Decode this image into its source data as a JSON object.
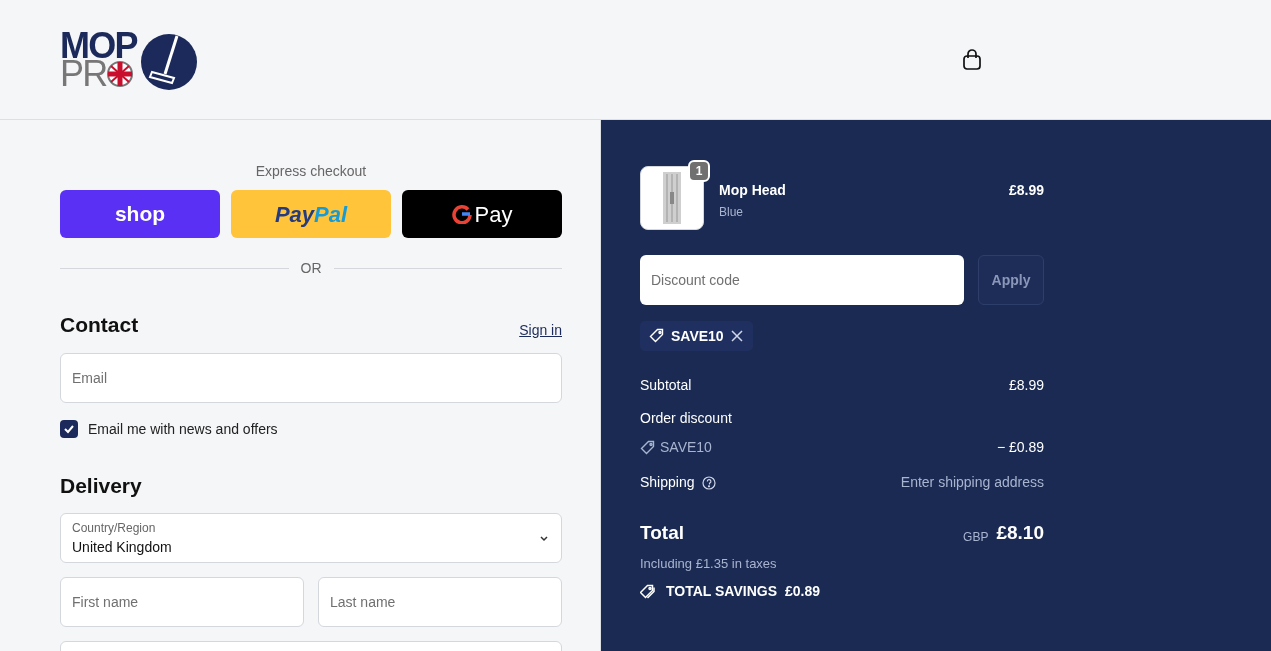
{
  "header": {
    "logo": {
      "top": "MOP",
      "bottom": "PR"
    }
  },
  "express_checkout": {
    "title": "Express checkout",
    "buttons": [
      {
        "kind": "shop",
        "label": "shop"
      },
      {
        "kind": "paypal",
        "label": "Pay",
        "label_2": "Pal"
      },
      {
        "kind": "gpay",
        "label": "Pay"
      }
    ],
    "divider": "OR"
  },
  "contact": {
    "title": "Contact",
    "sign_in": "Sign in",
    "email": {
      "placeholder": "Email"
    },
    "newsletter": {
      "label": "Email me with news and offers",
      "checked": true
    }
  },
  "delivery": {
    "title": "Delivery",
    "country": {
      "label": "Country/Region",
      "value": "United Kingdom"
    },
    "first_name": {
      "placeholder": "First name"
    },
    "last_name": {
      "placeholder": "Last name"
    }
  },
  "order": {
    "items": [
      {
        "name": "Mop Head",
        "variant": "Blue",
        "quantity": "1",
        "price": "£8.99"
      }
    ],
    "discount": {
      "placeholder": "Discount code",
      "apply": "Apply",
      "applied": [
        "SAVE10"
      ]
    },
    "subtotal": {
      "label": "Subtotal",
      "value": "£8.99"
    },
    "order_discount": {
      "label": "Order discount",
      "code": "SAVE10",
      "value": "− £0.89"
    },
    "shipping": {
      "label": "Shipping",
      "value": "Enter shipping address"
    },
    "total": {
      "label": "Total",
      "currency": "GBP",
      "value": "£8.10",
      "taxes": "Including £1.35 in taxes",
      "savings_label": "TOTAL SAVINGS",
      "savings_value": "£0.89"
    }
  }
}
